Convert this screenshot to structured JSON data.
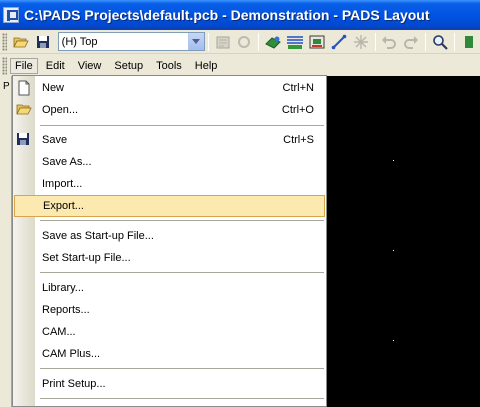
{
  "window": {
    "title": "C:\\PADS Projects\\default.pcb - Demonstration - PADS Layout"
  },
  "toolbar": {
    "layer_value": "(H) Top",
    "icons": [
      "open-folder-icon",
      "save-disk-icon",
      "layer-dropdown-arrow-icon",
      "properties-icon",
      "refresh-icon",
      "route-icon",
      "design-rules-icon",
      "cam-icon",
      "line-icon",
      "cross-icon",
      "undo-icon",
      "redo-icon",
      "zoom-icon",
      "misc-icon"
    ]
  },
  "menubar": {
    "items": [
      "File",
      "Edit",
      "View",
      "Setup",
      "Tools",
      "Help"
    ]
  },
  "side_panel": {
    "label": "P"
  },
  "file_menu": {
    "items": [
      {
        "label": "New",
        "shortcut": "Ctrl+N",
        "icon": "new-document-icon"
      },
      {
        "label": "Open...",
        "shortcut": "Ctrl+O",
        "icon": "open-folder-icon"
      },
      {
        "label": "Save",
        "shortcut": "Ctrl+S",
        "icon": "save-disk-icon"
      },
      {
        "label": "Save As..."
      },
      {
        "label": "Import..."
      },
      {
        "label": "Export...",
        "highlighted": true
      },
      {
        "label": "Save as Start-up File..."
      },
      {
        "label": "Set Start-up File..."
      },
      {
        "label": "Library..."
      },
      {
        "label": "Reports..."
      },
      {
        "label": "CAM..."
      },
      {
        "label": "CAM Plus..."
      },
      {
        "label": "Print Setup..."
      }
    ]
  },
  "colors": {
    "title_bar": "#0054e3",
    "menu_hover": "#fce9b0",
    "workspace": "#000000"
  }
}
